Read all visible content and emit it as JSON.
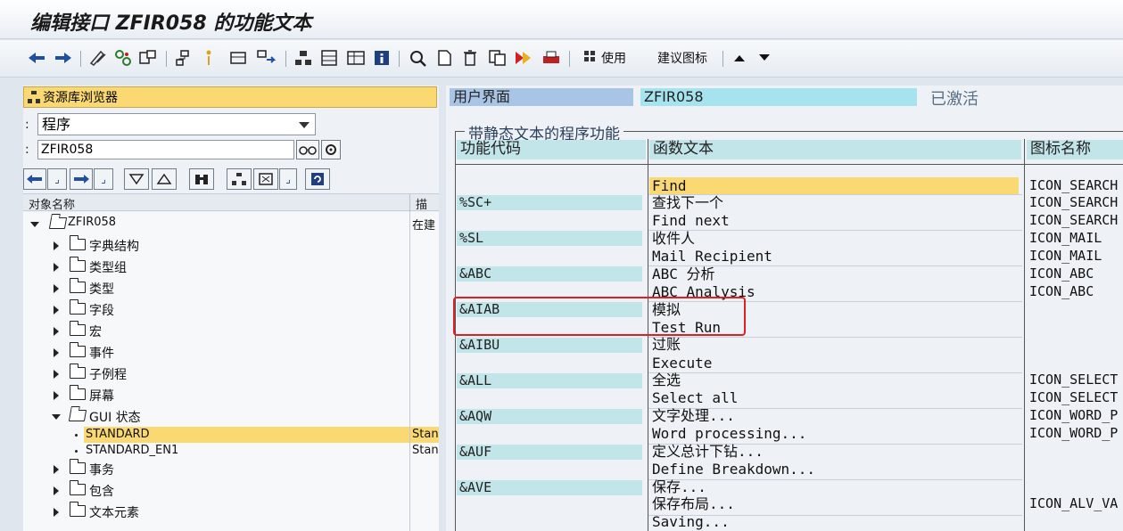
{
  "window": {
    "title": "编辑接口 ZFIR058 的功能文本"
  },
  "toolbar": {
    "use_label": "使用",
    "suggest_icons_label": "建议图标"
  },
  "left": {
    "repo_browser_label": "资源库浏览器",
    "object_type_value": "程序",
    "object_name_value": "ZFIR058",
    "tree_header": {
      "col_name": "对象名称",
      "col_desc": "描"
    },
    "tree": [
      {
        "label": "ZFIR058",
        "desc": "在建",
        "level": 0,
        "expanded": true
      },
      {
        "label": "字典结构",
        "level": 1
      },
      {
        "label": "类型组",
        "level": 1
      },
      {
        "label": "类型",
        "level": 1
      },
      {
        "label": "字段",
        "level": 1
      },
      {
        "label": "宏",
        "level": 1
      },
      {
        "label": "事件",
        "level": 1
      },
      {
        "label": "子例程",
        "level": 1
      },
      {
        "label": "屏幕",
        "level": 1
      },
      {
        "label": "GUI 状态",
        "level": 1,
        "expanded": true
      },
      {
        "label": "STANDARD",
        "desc": "Stan",
        "level": 2,
        "selected": true
      },
      {
        "label": "STANDARD_EN1",
        "desc": "Stan",
        "level": 2
      },
      {
        "label": "事务",
        "level": 1
      },
      {
        "label": "包含",
        "level": 1
      },
      {
        "label": "文本元素",
        "level": 1
      }
    ]
  },
  "right": {
    "ui_label": "用户界面",
    "ui_value": "ZFIR058",
    "ui_status": "已激活",
    "group_title": "带静态文本的程序功能",
    "col_code": "功能代码",
    "col_text": "函数文本",
    "col_icon": "图标名称",
    "codes": [
      "%SC+",
      "%SL",
      "&ABC",
      "&AIAB",
      "&AIBU",
      "&ALL",
      "&AQW",
      "&AUF",
      "&AVE"
    ],
    "texts": [
      "Find",
      "查找下一个",
      "Find next",
      "收件人",
      "Mail Recipient",
      "ABC 分析",
      "ABC Analysis",
      "模拟",
      "Test Run",
      "过账",
      "Execute",
      "全选",
      "Select all",
      "文字处理...",
      "Word processing...",
      "定义总计下钻...",
      "Define Breakdown...",
      "保存...",
      "保存布局...",
      "Saving..."
    ],
    "icons": [
      "ICON_SEARCH",
      "ICON_SEARCH",
      "ICON_SEARCH",
      "ICON_MAIL",
      "ICON_MAIL",
      "ICON_ABC",
      "ICON_ABC",
      "",
      "",
      "",
      "",
      "ICON_SELECT",
      "ICON_SELECT",
      "ICON_WORD_P",
      "ICON_WORD_P",
      "",
      "",
      "",
      "ICON_ALV_VA",
      ""
    ]
  }
}
